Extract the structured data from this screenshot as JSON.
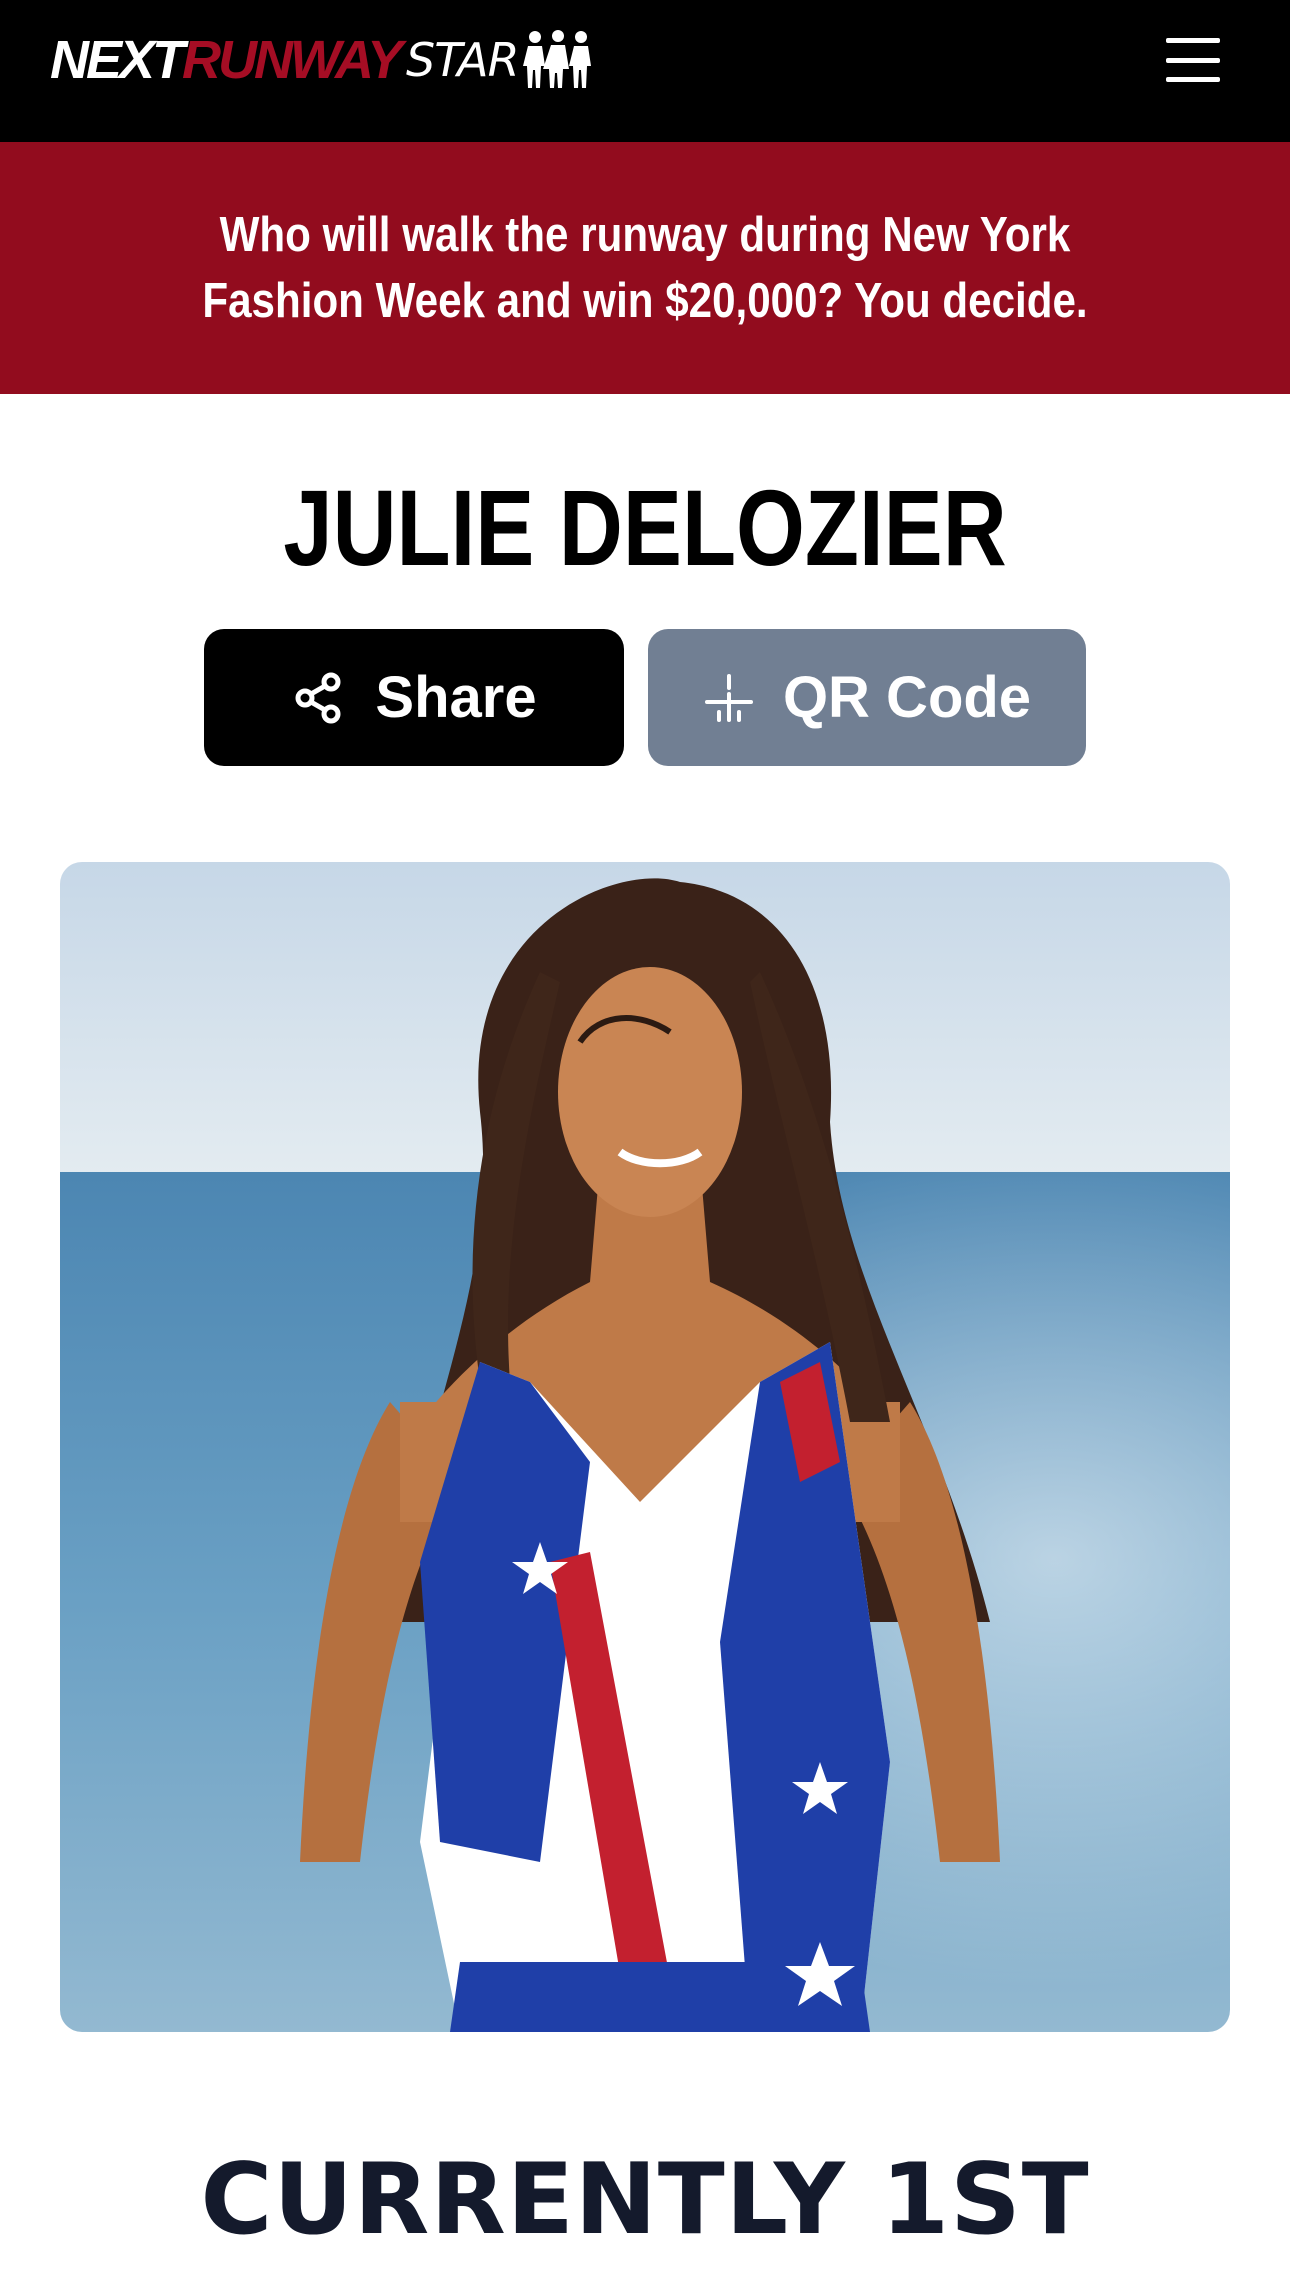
{
  "header": {
    "logo": {
      "part1": "NEXT",
      "part2": "RUNWAY",
      "part3": "STAR"
    },
    "menu_icon": "hamburger-menu-icon"
  },
  "banner": {
    "text": "Who will walk the runway during New York Fashion Week and win $20,000?  You decide."
  },
  "contestant": {
    "name": "JULIE DELOZIER",
    "rank_text": "CURRENTLY 1ST"
  },
  "actions": {
    "share_label": "Share",
    "share_icon": "share-icon",
    "qr_label": "QR Code",
    "qr_icon": "qr-code-icon"
  },
  "colors": {
    "topbar": "#000000",
    "brand_red": "#a50d24",
    "banner_bg": "#920c1e",
    "share_bg": "#000000",
    "qr_bg": "#717f93",
    "rank_text": "#141a2c"
  }
}
